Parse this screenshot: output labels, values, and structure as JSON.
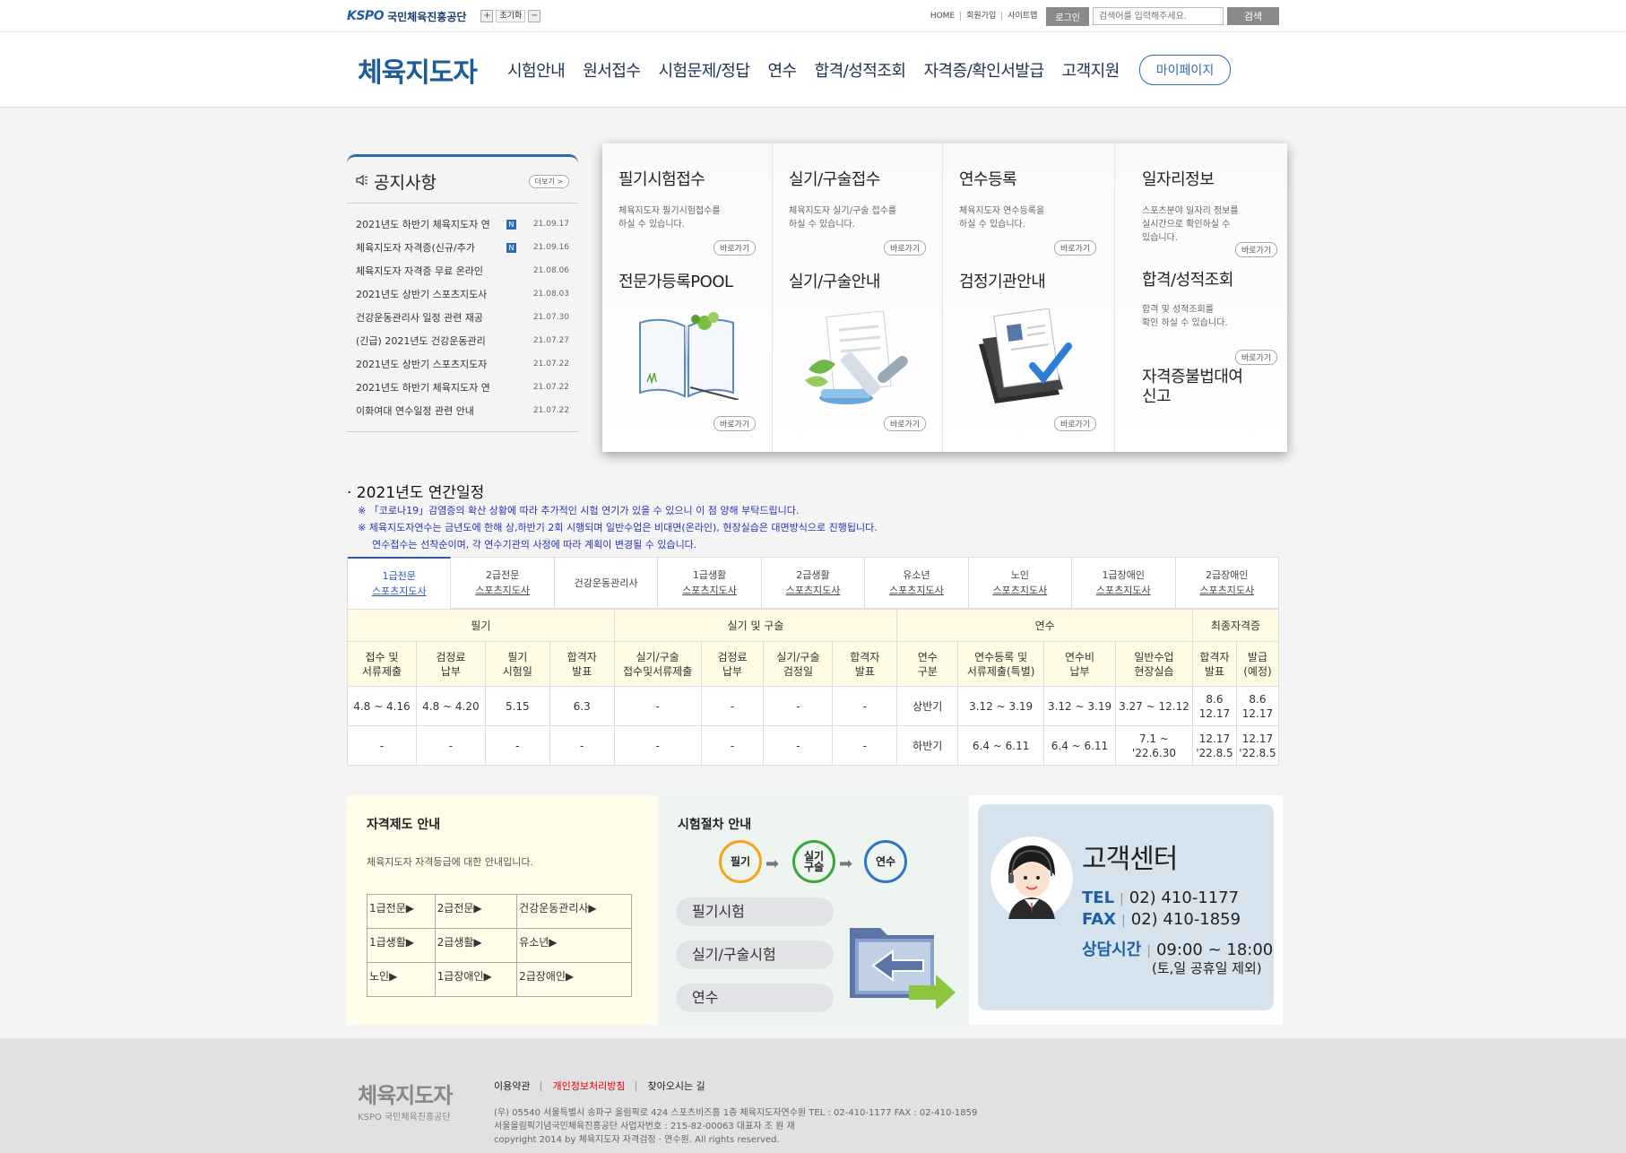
{
  "topbar": {
    "brand_mark": "KSPO",
    "brand_org": "국민체육진흥공단",
    "font_plus": "+",
    "font_reset": "초기화",
    "font_minus": "−",
    "links": [
      "HOME",
      "회원가입",
      "사이트맵"
    ],
    "login": "로그인",
    "search_placeholder": "검색어를 입력해주세요.",
    "search_button": "검색"
  },
  "header": {
    "title": "체육지도자",
    "nav": [
      "시험안내",
      "원서접수",
      "시험문제/정답",
      "연수",
      "합격/성적조회",
      "자격증/확인서발급",
      "고객지원"
    ],
    "mypage": "마이페이지"
  },
  "notice": {
    "title": "공지사항",
    "more": "더보기 >",
    "items": [
      {
        "text": "2021년도 하반기 체육지도자 연",
        "new": "N",
        "date": "21.09.17"
      },
      {
        "text": "체육지도자 자격증(신규/추가",
        "new": "N",
        "date": "21.09.16"
      },
      {
        "text": "체육지도자 자격증 무료 온라인",
        "new": "",
        "date": "21.08.06"
      },
      {
        "text": "2021년도 상반기 스포츠지도사",
        "new": "",
        "date": "21.08.03"
      },
      {
        "text": "건강운동관리사 일정 관련 재공",
        "new": "",
        "date": "21.07.30"
      },
      {
        "text": "(긴급) 2021년도 건강운동관리",
        "new": "",
        "date": "21.07.27"
      },
      {
        "text": "2021년도 상반기 스포츠지도자",
        "new": "",
        "date": "21.07.22"
      },
      {
        "text": "2021년도 하반기 체육지도자 연",
        "new": "",
        "date": "21.07.22"
      },
      {
        "text": "이화여대 연수일정 관련 안내",
        "new": "",
        "date": "21.07.22"
      }
    ]
  },
  "quick": {
    "go": "바로가기",
    "col1": {
      "title": "필기시험접수",
      "desc1": "체육지도자 필기시험접수를",
      "desc2": "하실 수 있습니다.",
      "title2": "전문가등록POOL"
    },
    "col2": {
      "title": "실기/구술접수",
      "desc1": "체육지도자 실기/구술 접수를",
      "desc2": "하실 수 있습니다.",
      "title2": "실기/구술안내"
    },
    "col3": {
      "title": "연수등록",
      "desc1": "체육지도자 연수등록을",
      "desc2": "하실 수 있습니다.",
      "title2": "검정기관안내"
    },
    "col4": {
      "title": "일자리정보",
      "desc1": "스포츠분야 일자리 정보를",
      "desc2": "실시간으로 확인하실 수",
      "desc3": "있습니다.",
      "title2": "합격/성적조회",
      "desc4": "합격 및 성적조회를",
      "desc5": "확인 하실 수 있습니다.",
      "title3a": "자격증불법대여",
      "title3b": "신고"
    }
  },
  "schedule": {
    "title": "· 2021년도 연간일정",
    "note1": "※ 「코로나19」감염증의 확산 상황에 따라 추가적인 시험 연기가 있을 수 있으니 이 점 양해 부탁드립니다.",
    "note2": "※ 체육지도자연수는 금년도에 한해 상,하반기 2회 시행되며 일반수업은 비대면(온라인), 현장실습은 대면방식으로 진행됩니다.",
    "note3": "연수접수는 선착순이며, 각 연수기관의 사정에 따라 계획이 변경될 수 있습니다.",
    "tabs": [
      {
        "l1": "1급전문",
        "l2": "스포츠지도사"
      },
      {
        "l1": "2급전문",
        "l2": "스포츠지도사"
      },
      {
        "l1": "건강운동관리사",
        "l2": ""
      },
      {
        "l1": "1급생활",
        "l2": "스포츠지도사"
      },
      {
        "l1": "2급생활",
        "l2": "스포츠지도사"
      },
      {
        "l1": "유소년",
        "l2": "스포츠지도사"
      },
      {
        "l1": "노인",
        "l2": "스포츠지도사"
      },
      {
        "l1": "1급장애인",
        "l2": "스포츠지도사"
      },
      {
        "l1": "2급장애인",
        "l2": "스포츠지도사"
      }
    ],
    "groups": [
      "필기",
      "실기 및 구술",
      "연수",
      "최종자격증"
    ],
    "cols": [
      [
        "접수 및",
        "서류제출"
      ],
      [
        "검정료",
        "납부"
      ],
      [
        "필기",
        "시험일"
      ],
      [
        "합격자",
        "발표"
      ],
      [
        "실기/구술",
        "접수및서류제출"
      ],
      [
        "검정료",
        "납부"
      ],
      [
        "실기/구술",
        "검정일"
      ],
      [
        "합격자",
        "발표"
      ],
      [
        "연수",
        "구분"
      ],
      [
        "연수등록 및",
        "서류제출(특별)"
      ],
      [
        "연수비",
        "납부"
      ],
      [
        "일반수업",
        "현장실습"
      ],
      [
        "합격자",
        "발표"
      ],
      [
        "발급",
        "(예정)"
      ]
    ],
    "rows": [
      [
        [
          "4.8 ~ 4.16"
        ],
        [
          "4.8 ~ 4.20"
        ],
        [
          "5.15"
        ],
        [
          "6.3"
        ],
        [
          "-"
        ],
        [
          "-"
        ],
        [
          "-"
        ],
        [
          "-"
        ],
        [
          "상반기"
        ],
        [
          "3.12 ~ 3.19"
        ],
        [
          "3.12 ~ 3.19"
        ],
        [
          "3.27 ~ 12.12"
        ],
        [
          "8.6",
          "12.17"
        ],
        [
          "8.6",
          "12.17"
        ]
      ],
      [
        [
          "-"
        ],
        [
          "-"
        ],
        [
          "-"
        ],
        [
          "-"
        ],
        [
          "-"
        ],
        [
          "-"
        ],
        [
          "-"
        ],
        [
          "-"
        ],
        [
          "하반기"
        ],
        [
          "6.4 ~ 6.11"
        ],
        [
          "6.4 ~ 6.11"
        ],
        [
          "7.1 ~ '22.6.30"
        ],
        [
          "12.17",
          "'22.8.5"
        ],
        [
          "12.17",
          "'22.8.5"
        ]
      ]
    ]
  },
  "qual": {
    "title": "자격제도 안내",
    "desc": "체육지도자 자격등급에 대한 안내입니다.",
    "grid": [
      [
        "1급전문▶",
        "2급전문▶",
        "건강운동관리사▶"
      ],
      [
        "1급생활▶",
        "2급생활▶",
        "유소년▶"
      ],
      [
        "노인▶",
        "1급장애인▶",
        "2급장애인▶"
      ]
    ]
  },
  "process": {
    "title": "시험절차 안내",
    "steps": [
      "필기",
      "실기\n구술",
      "연수"
    ],
    "pills": [
      "필기시험",
      "실기/구술시험",
      "연수"
    ],
    "colors": {
      "step1": "#f2a51a",
      "step2": "#3aa640",
      "step3": "#2e76c4",
      "arrow": "#8cc63f"
    }
  },
  "cs": {
    "title": "고객센터",
    "tel_label": "TEL",
    "tel": "02) 410-1177",
    "fax_label": "FAX",
    "fax": "02) 410-1859",
    "hours_label": "상담시간",
    "hours": "09:00 ~ 18:00",
    "hours_note": "(토,일 공휴일 제외)"
  },
  "footer": {
    "logo_title": "체육지도자",
    "logo_sub": "KSPO 국민체육진흥공단",
    "links": [
      "이용약관",
      "개인정보처리방침",
      "찾아오시는 길"
    ],
    "addr": "(우) 05540 서울특별시 송파구 올림픽로 424 스포츠비즈홈 1층 체육지도자연수원 TEL : 02-410-1177 FAX : 02-410-1859",
    "biz": "서울올림픽기념국민체육진흥공단 사업자번호 : 215-82-00063 대표자 조 원 재",
    "copy": "copyright 2014 by 체육지도자 자격검정 · 연수원. All rights reserved."
  }
}
